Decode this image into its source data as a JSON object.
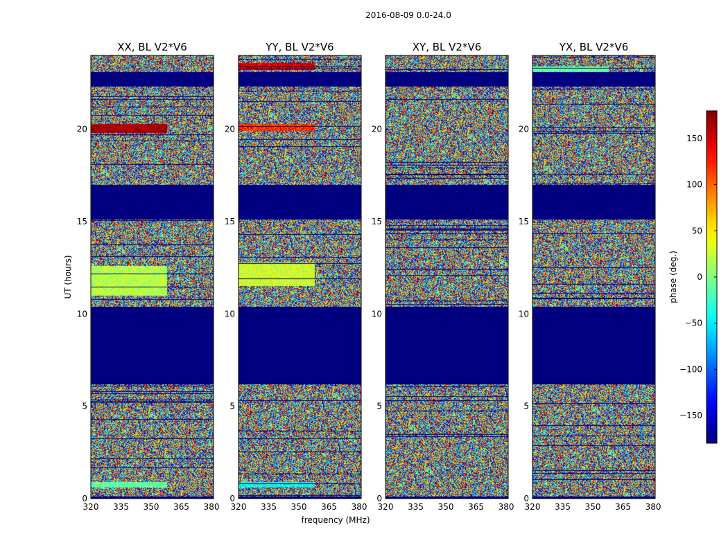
{
  "figure": {
    "suptitle": "2016-08-09 0.0-24.0",
    "xlabel": "frequency (MHz)",
    "ylabel": "UT (hours)",
    "colorbar_label": "phase (deg.)",
    "colorbar_ticks": [
      "150",
      "100",
      "50",
      "0",
      "−50",
      "−100",
      "−150"
    ]
  },
  "chart_data": [
    {
      "type": "heatmap",
      "title": "XX, BL V2*V6",
      "xlim": [
        320,
        381
      ],
      "ylim": [
        0,
        24
      ],
      "x_ticks": [
        "320",
        "335",
        "350",
        "365",
        "380"
      ],
      "y_ticks": [
        "0",
        "5",
        "10",
        "15",
        "20"
      ],
      "value_range": [
        -180,
        180
      ],
      "colormap": "jet",
      "empty_bands_hours": [
        [
          0.0,
          0.1
        ],
        [
          6.2,
          10.4
        ],
        [
          15.1,
          17.0
        ],
        [
          22.3,
          23.1
        ]
      ],
      "coherent_bands": [
        [
          0.6,
          0.9,
          -10
        ],
        [
          11.0,
          12.6,
          20
        ],
        [
          19.8,
          20.3,
          170
        ]
      ]
    },
    {
      "type": "heatmap",
      "title": "YY, BL V2*V6",
      "xlim": [
        320,
        381
      ],
      "ylim": [
        0,
        24
      ],
      "x_ticks": [
        "320",
        "335",
        "350",
        "365",
        "380"
      ],
      "y_ticks": [
        "0",
        "5",
        "10",
        "15",
        "20"
      ],
      "value_range": [
        -180,
        180
      ],
      "colormap": "jet",
      "empty_bands_hours": [
        [
          0.0,
          0.1
        ],
        [
          6.2,
          10.4
        ],
        [
          15.1,
          17.0
        ],
        [
          22.3,
          23.1
        ]
      ],
      "coherent_bands": [
        [
          0.6,
          0.9,
          -40
        ],
        [
          11.5,
          12.8,
          30
        ],
        [
          19.9,
          20.3,
          120
        ],
        [
          23.2,
          23.6,
          150
        ]
      ]
    },
    {
      "type": "heatmap",
      "title": "XY, BL V2*V6",
      "xlim": [
        320,
        381
      ],
      "ylim": [
        0,
        24
      ],
      "x_ticks": [
        "320",
        "335",
        "350",
        "365",
        "380"
      ],
      "y_ticks": [
        "0",
        "5",
        "10",
        "15",
        "20"
      ],
      "value_range": [
        -180,
        180
      ],
      "colormap": "jet",
      "empty_bands_hours": [
        [
          0.0,
          0.1
        ],
        [
          6.2,
          10.4
        ],
        [
          15.1,
          17.0
        ],
        [
          22.3,
          23.1
        ]
      ],
      "coherent_bands": []
    },
    {
      "type": "heatmap",
      "title": "YX, BL V2*V6",
      "xlim": [
        320,
        381
      ],
      "ylim": [
        0,
        24
      ],
      "x_ticks": [
        "320",
        "335",
        "350",
        "365",
        "380"
      ],
      "y_ticks": [
        "0",
        "5",
        "10",
        "15",
        "20"
      ],
      "value_range": [
        -180,
        180
      ],
      "colormap": "jet",
      "empty_bands_hours": [
        [
          0.0,
          0.1
        ],
        [
          6.2,
          10.4
        ],
        [
          15.1,
          17.0
        ],
        [
          22.3,
          23.1
        ]
      ],
      "coherent_bands": [
        [
          23.1,
          23.4,
          -10
        ]
      ]
    }
  ]
}
